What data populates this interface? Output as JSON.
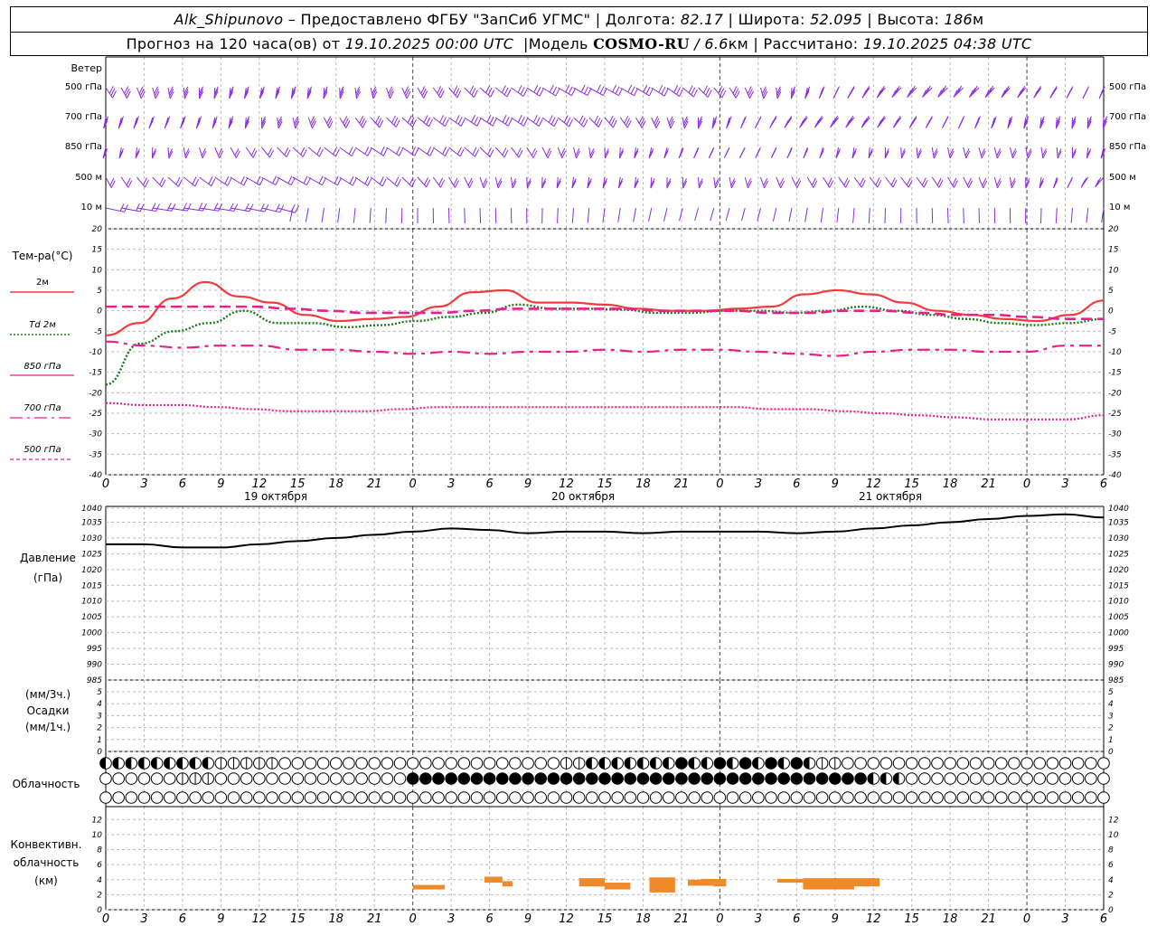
{
  "header": {
    "station": "Alk_Shipunovo",
    "provider_text": "– Предоставлено ФГБУ \"ЗапСиб УГМС\"",
    "lon_label": "Долгота:",
    "lon_value": "82.17",
    "lat_label": "Широта:",
    "lat_value": "52.095",
    "alt_label": "Высота:",
    "alt_value": "186",
    "alt_unit": "м",
    "forecast_prefix": "Прогноз на 120 часа(ов) от",
    "forecast_time": "19.10.2025 00:00 UTC",
    "model_label": "Модель",
    "model_name": "COSMO-RU",
    "model_res": "/ 6.6",
    "model_res_unit": "км",
    "calc_label": "Рассчитано:",
    "calc_time": "19.10.2025 04:38 UTC"
  },
  "x_axis": {
    "hour_ticks": [
      "0",
      "3",
      "6",
      "9",
      "12",
      "15",
      "18",
      "21",
      "0",
      "3",
      "6",
      "9",
      "12",
      "15",
      "18",
      "21",
      "0",
      "3",
      "6",
      "9",
      "12",
      "15",
      "18",
      "21",
      "0",
      "3",
      "6"
    ],
    "days": [
      "19 октября",
      "20 октября",
      "21 октября"
    ]
  },
  "wind_panel": {
    "title": "Ветер",
    "levels": [
      "500 гПа",
      "700 гПа",
      "850 гПа",
      "500 м",
      "10 м"
    ],
    "color": "#8a2be2"
  },
  "temp_panel": {
    "title": "Тем-ра(°C)",
    "y_ticks": [
      "20",
      "15",
      "10",
      "5",
      "0",
      "-5",
      "-10",
      "-15",
      "-20",
      "-25",
      "-30",
      "-35",
      "-40"
    ],
    "legend": [
      {
        "label": "2м",
        "color": "#f03c3c",
        "style": "solid"
      },
      {
        "label": "Td  2м",
        "color": "#1a7a1a",
        "style": "dotted"
      },
      {
        "label": "850 гПа",
        "color": "#e8208a",
        "style": "dashed"
      },
      {
        "label": "700 гПа",
        "color": "#e8208a",
        "style": "dashdot"
      },
      {
        "label": "500 гПа",
        "color": "#e8208a",
        "style": "dots"
      }
    ]
  },
  "pressure_panel": {
    "title": "Давление",
    "unit": "(гПа)",
    "y_ticks": [
      "1040",
      "1035",
      "1030",
      "1025",
      "1020",
      "1015",
      "1010",
      "1005",
      "1000",
      "995",
      "990",
      "985"
    ]
  },
  "precip_panel": {
    "unit_top": "(мм/3ч.)",
    "title": "Осадки",
    "unit_bottom": "(мм/1ч.)",
    "y_ticks": [
      "5",
      "4",
      "3",
      "2",
      "1",
      "0"
    ]
  },
  "cloud_panel": {
    "title": "Облачность"
  },
  "conv_panel": {
    "title_1": "Конвективн.",
    "title_2": "облачность",
    "unit": "(км)",
    "y_ticks": [
      "12",
      "10",
      "8",
      "6",
      "4",
      "2",
      "0"
    ],
    "color": "#f08a28"
  },
  "chart_data": [
    {
      "type": "line",
      "title": "Тем-ра(°C)",
      "ylim": [
        -40,
        20
      ],
      "x_hours": [
        0,
        3,
        6,
        9,
        12,
        15,
        18,
        21,
        24,
        27,
        30,
        33,
        36,
        39,
        42,
        45,
        48,
        51,
        54,
        57,
        60,
        63,
        66,
        69,
        72,
        75,
        78
      ],
      "series": [
        {
          "name": "2м",
          "values": [
            -6,
            -3,
            3,
            7,
            3.5,
            2,
            -1,
            -2.5,
            -2,
            -1.5,
            1,
            4.5,
            5,
            2,
            2,
            1.5,
            0.5,
            0,
            0,
            0.5,
            1,
            4,
            5,
            4,
            2,
            0,
            -1,
            -2,
            -2.5,
            -1,
            2.5
          ]
        },
        {
          "name": "Td  2м",
          "values": [
            -18,
            -8,
            -5,
            -3,
            0,
            -3,
            -3,
            -4,
            -3.5,
            -2.5,
            -1.5,
            -0.5,
            1.5,
            0.5,
            0.5,
            0.3,
            -0.5,
            -0.5,
            0,
            0,
            -0.5,
            0,
            1,
            0,
            -1,
            -2,
            -3,
            -3.5,
            -3,
            -2
          ]
        },
        {
          "name": "850 гПа",
          "values": [
            1,
            1,
            1,
            1,
            1,
            0.5,
            0,
            -0.5,
            -0.5,
            -0.5,
            0,
            0.5,
            0.5,
            0.5,
            0.5,
            0,
            0,
            0,
            -0.5,
            -0.5,
            0,
            0,
            -0.5,
            -1,
            -1,
            -1.5,
            -2,
            -2
          ]
        },
        {
          "name": "700 гПа",
          "values": [
            -7.5,
            -8.5,
            -9,
            -8.5,
            -8.5,
            -9.5,
            -9.5,
            -10,
            -10.5,
            -10,
            -10.5,
            -10,
            -10,
            -9.5,
            -10,
            -9.5,
            -9.5,
            -10,
            -10.5,
            -11,
            -10,
            -9.5,
            -9.5,
            -10,
            -10,
            -8.5,
            -8.5
          ]
        },
        {
          "name": "500 гПа",
          "values": [
            -22.5,
            -23,
            -23,
            -23.5,
            -24,
            -24.5,
            -24.5,
            -24.5,
            -24,
            -23.5,
            -23.5,
            -23.5,
            -23.5,
            -23.5,
            -23.5,
            -23.5,
            -23.5,
            -23.5,
            -24,
            -24,
            -24.5,
            -25,
            -25.5,
            -26,
            -26.5,
            -26.5,
            -26.5,
            -25.5
          ]
        }
      ]
    },
    {
      "type": "line",
      "title": "Давление",
      "ylim": [
        985,
        1040
      ],
      "series": [
        {
          "name": "",
          "values": [
            1028,
            1028,
            1027,
            1027,
            1028,
            1029,
            1030,
            1031,
            1032,
            1033,
            1032.5,
            1031.5,
            1032,
            1032,
            1031.5,
            1032,
            1032,
            1032,
            1031.5,
            1032,
            1033,
            1034,
            1035,
            1036,
            1037,
            1037.5,
            1036.5
          ]
        }
      ]
    }
  ]
}
